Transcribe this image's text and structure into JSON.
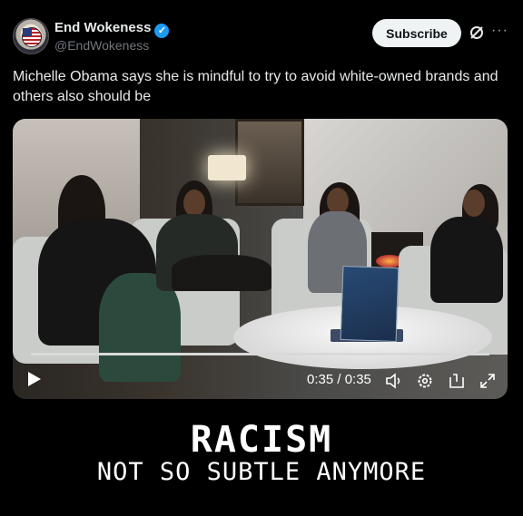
{
  "account": {
    "name": "End Wokeness",
    "handle": "@EndWokeness",
    "verified": true
  },
  "actions": {
    "subscribe_label": "Subscribe",
    "more_label": "···"
  },
  "tweet": {
    "text": "Michelle Obama says she is mindful to try to avoid white-owned brands and others also should be"
  },
  "video": {
    "time": "0:35 / 0:35",
    "progress": 1.0
  },
  "caption": {
    "line1": "RACISM",
    "line2": "NOT SO SUBTLE ANYMORE"
  },
  "icons": [
    "grok-icon",
    "play-icon",
    "volume-icon",
    "settings-icon",
    "pip-icon",
    "fullscreen-icon"
  ],
  "colors": {
    "background": "#000000",
    "verified": "#1d9bf0",
    "subscribe_bg": "#eff3f4"
  }
}
